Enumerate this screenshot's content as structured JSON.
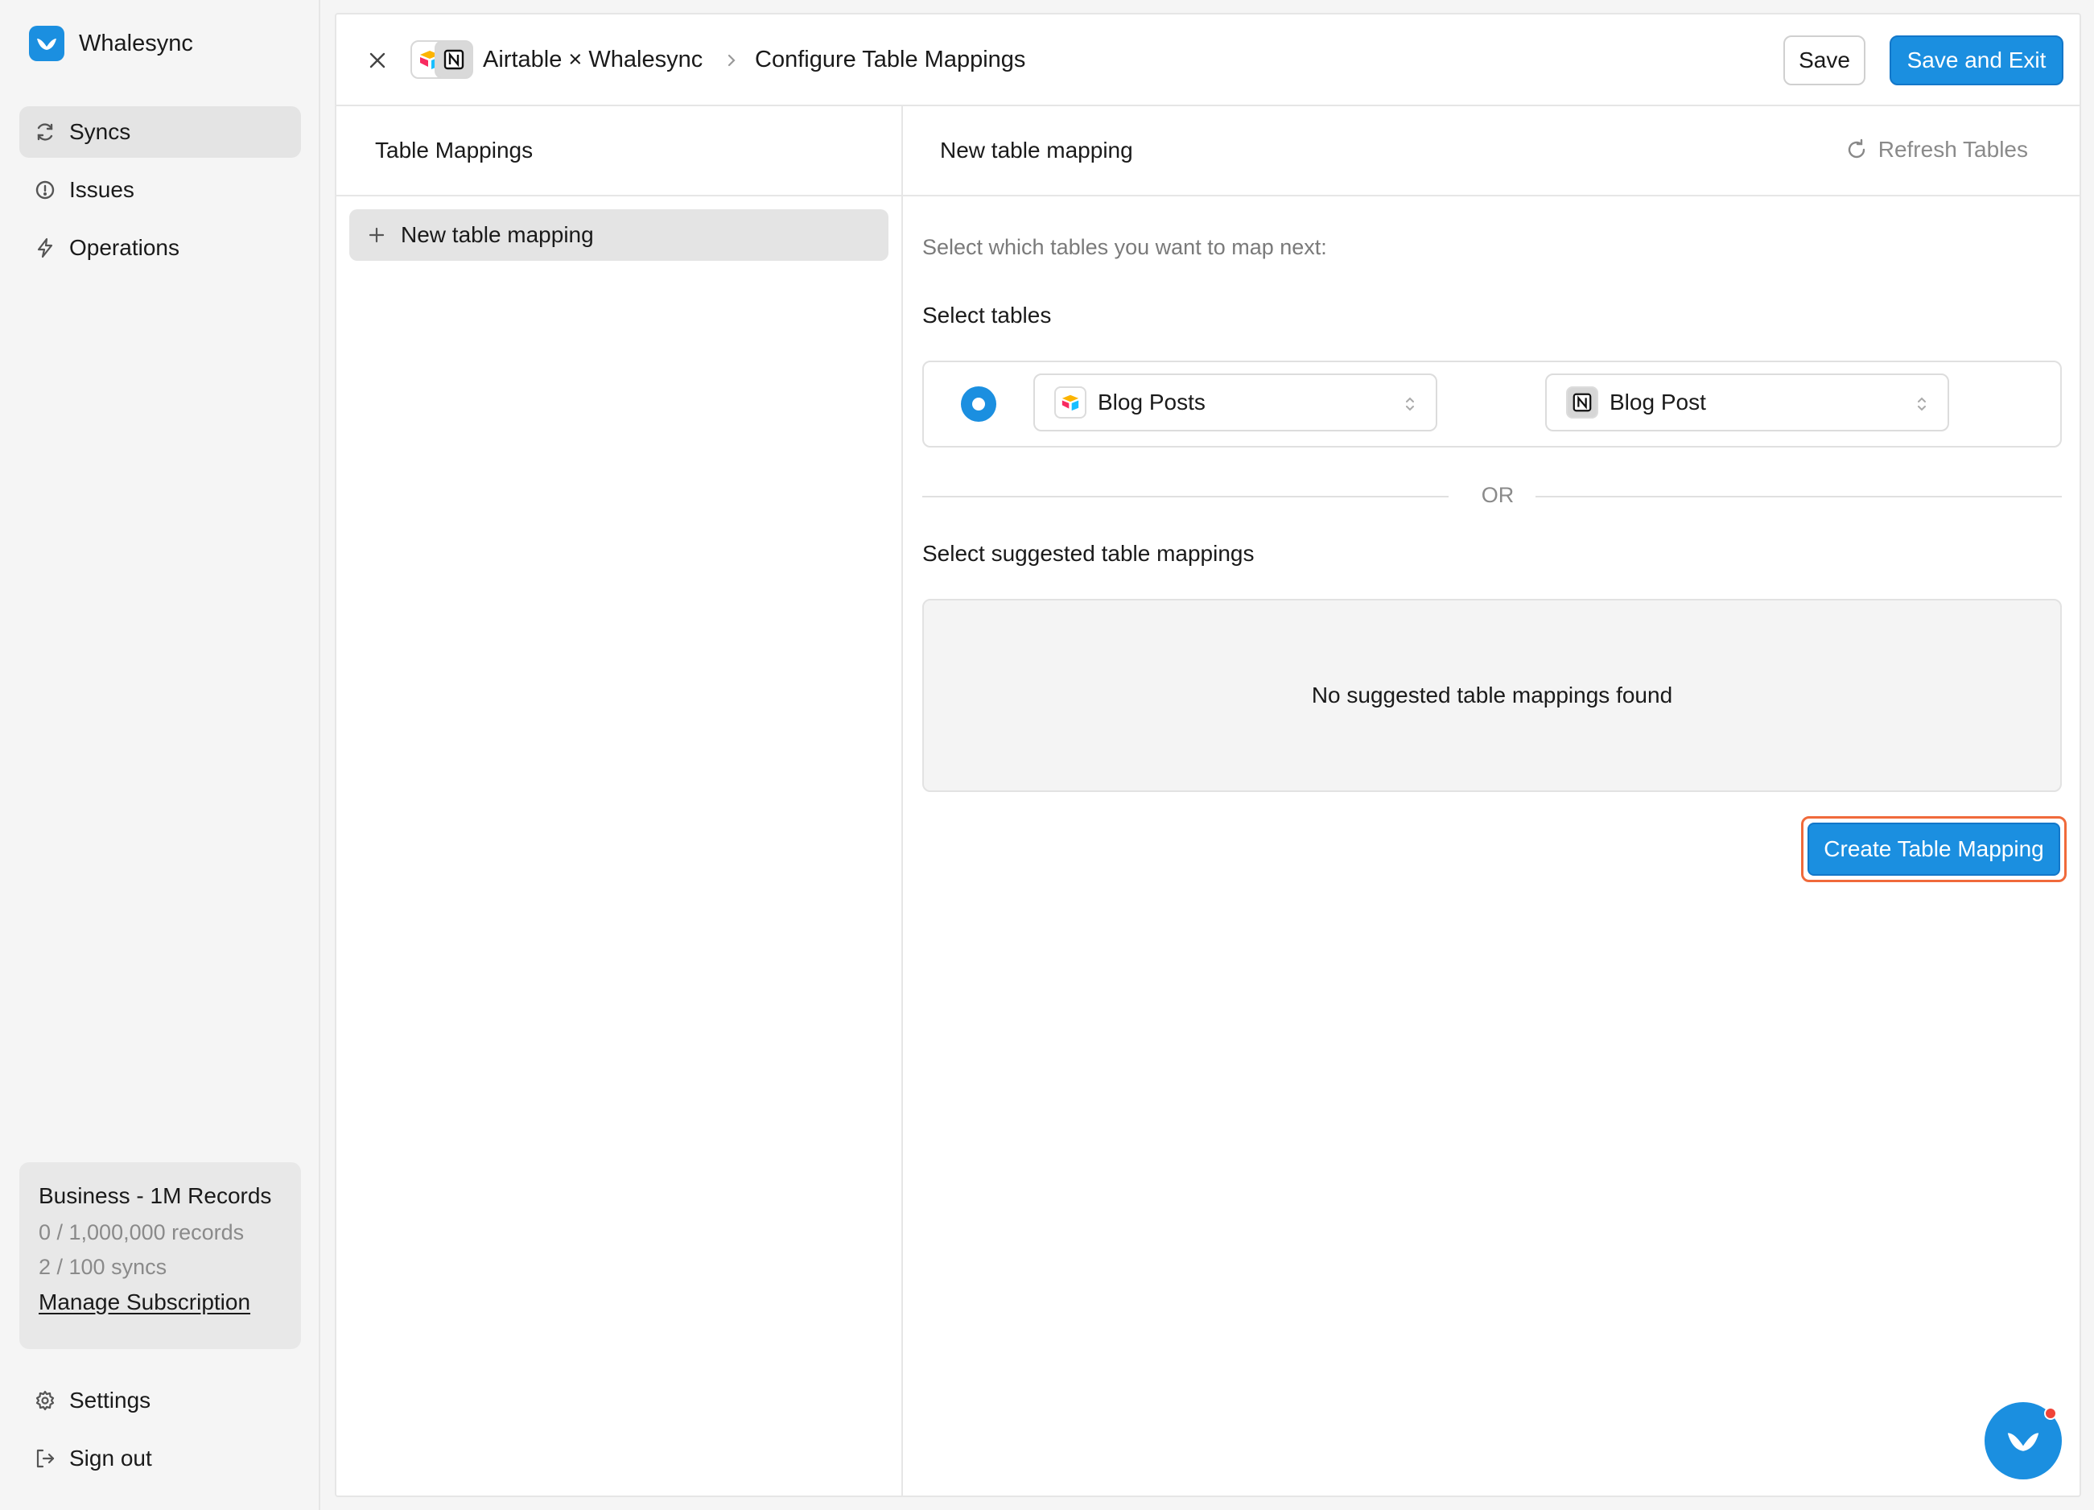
{
  "brand": {
    "name": "Whalesync"
  },
  "sidebar": {
    "items": [
      {
        "label": "Syncs",
        "icon": "refresh-icon",
        "active": true
      },
      {
        "label": "Issues",
        "icon": "alert-circle-icon",
        "active": false
      },
      {
        "label": "Operations",
        "icon": "bolt-icon",
        "active": false
      }
    ],
    "plan": {
      "name": "Business - 1M Records",
      "records": "0 / 1,000,000 records",
      "syncs": "2 / 100 syncs",
      "manage_label": "Manage Subscription"
    },
    "bottom": [
      {
        "label": "Settings",
        "icon": "gear-icon"
      },
      {
        "label": "Sign out",
        "icon": "sign-out-icon"
      }
    ]
  },
  "header": {
    "breadcrumb_1": "Airtable × Whalesync",
    "breadcrumb_2": "Configure Table Mappings",
    "save_label": "Save",
    "save_exit_label": "Save and Exit"
  },
  "left_panel": {
    "title": "Table Mappings",
    "new_item_label": "New table mapping"
  },
  "right_panel": {
    "title": "New table mapping",
    "refresh_label": "Refresh Tables",
    "hint": "Select which tables you want to map next:",
    "select_tables_label": "Select tables",
    "source_table": "Blog Posts",
    "target_table": "Blog Post",
    "or_label": "OR",
    "suggested_label": "Select suggested table mappings",
    "empty_message": "No suggested table mappings found",
    "create_label": "Create Table Mapping"
  },
  "colors": {
    "accent": "#1b8fe0",
    "highlight": "#f06a3b",
    "notification": "#f04438"
  }
}
